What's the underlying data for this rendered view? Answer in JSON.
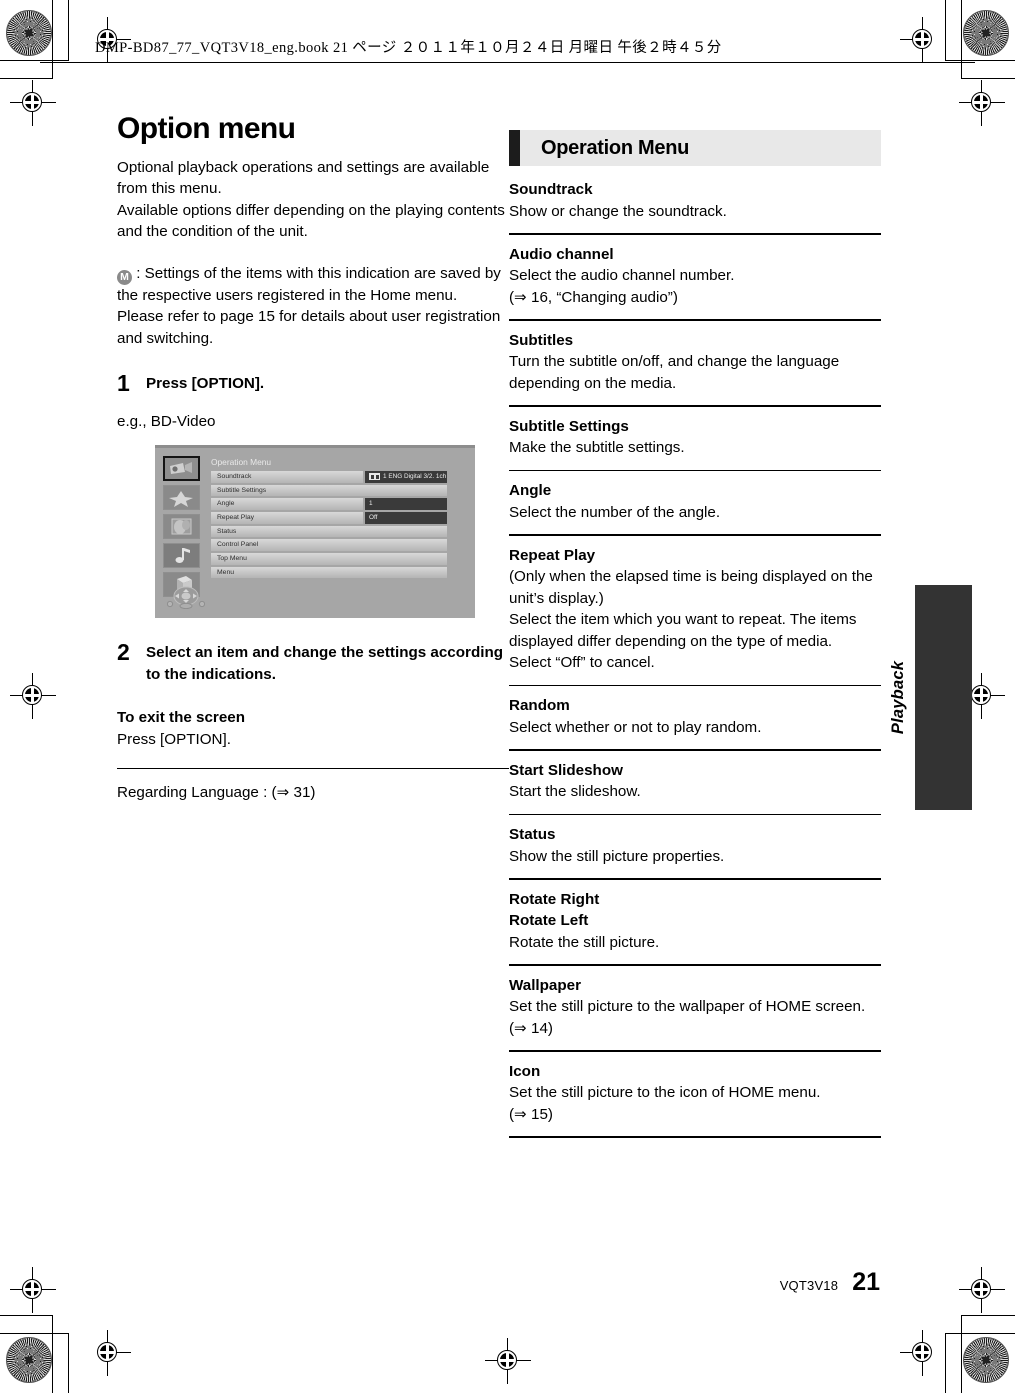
{
  "slug": {
    "text": "DMP-BD87_77_VQT3V18_eng.book  21 ページ  ２０１１年１０月２４日  月曜日  午後２時４５分"
  },
  "left": {
    "title": "Option menu",
    "intro1": "Optional playback operations and settings are available from this menu.",
    "intro2": "Available options differ depending on the playing contents and the condition of the unit.",
    "badge_letter": "M",
    "badge_note1": " : Settings of the items with this indication are saved by the respective users registered in the Home menu.",
    "badge_note2": "Please refer to page 15 for details about user registration and switching.",
    "step1_num": "1",
    "step1_text": "Press [OPTION].",
    "eg_label": "e.g., BD-Video",
    "step2_num": "2",
    "step2_text": "Select an item and change the settings according to the indications.",
    "exit_head": "To exit the screen",
    "exit_text": "Press [OPTION].",
    "language_note": "Regarding Language : (⇒ 31)"
  },
  "device_screen": {
    "title": "Operation Menu",
    "rows": [
      {
        "label": "Soundtrack",
        "value": "1 ENG Digital 3/2. 1ch",
        "has_speaker_icon": true
      },
      {
        "label": "Subtitle Settings",
        "value": null,
        "has_speaker_icon": false
      },
      {
        "label": "Angle",
        "value": "1",
        "has_speaker_icon": false
      },
      {
        "label": "Repeat Play",
        "value": "Off",
        "has_speaker_icon": false
      },
      {
        "label": "Status",
        "value": null,
        "has_speaker_icon": false
      },
      {
        "label": "Control Panel",
        "value": null,
        "has_speaker_icon": false
      },
      {
        "label": "Top Menu",
        "value": null,
        "has_speaker_icon": false
      },
      {
        "label": "Menu",
        "value": null,
        "has_speaker_icon": false
      }
    ],
    "rail_icons": [
      "video-camera-icon",
      "star-disc-icon",
      "photo-icon",
      "music-note-icon",
      "cube-icon"
    ],
    "dpad_icon": "dpad-navigation-icon"
  },
  "right": {
    "header": "Operation Menu",
    "entries": [
      {
        "name": "Soundtrack",
        "desc": "Show or change the soundtrack."
      },
      {
        "name": "Audio channel",
        "desc": "Select the audio channel number.\n(⇒ 16, “Changing audio”)"
      },
      {
        "name": "Subtitles",
        "desc": "Turn the subtitle on/off, and change the language depending on the media."
      },
      {
        "name": "Subtitle Settings",
        "desc": "Make the subtitle settings."
      },
      {
        "name": "Angle",
        "desc": "Select the number of the angle."
      },
      {
        "name": "Repeat Play",
        "desc": "(Only when the elapsed time is being displayed on the unit’s display.)\nSelect the item which you want to repeat. The items displayed differ depending on the type of media.\nSelect “Off” to cancel."
      },
      {
        "name": "Random",
        "desc": "Select whether or not to play random."
      },
      {
        "name": "Start Slideshow",
        "desc": "Start the slideshow."
      },
      {
        "name": "Status",
        "desc": "Show the still picture properties."
      },
      {
        "name": "Rotate Right\nRotate Left",
        "desc": "Rotate the still picture."
      },
      {
        "name": "Wallpaper",
        "desc": "Set the still picture to the wallpaper of HOME screen. (⇒ 14)"
      },
      {
        "name": "Icon",
        "desc": "Set the still picture to the icon of HOME menu.\n(⇒ 15)"
      }
    ]
  },
  "side_tab": {
    "label": "Playback"
  },
  "footer": {
    "code": "VQT3V18",
    "page": "21"
  },
  "colors": {
    "accent_dark": "#1c1c1c",
    "header_bg": "#e8e8e8",
    "side_tab_bg": "#333333",
    "screen_bg": "#a6a6a6"
  }
}
